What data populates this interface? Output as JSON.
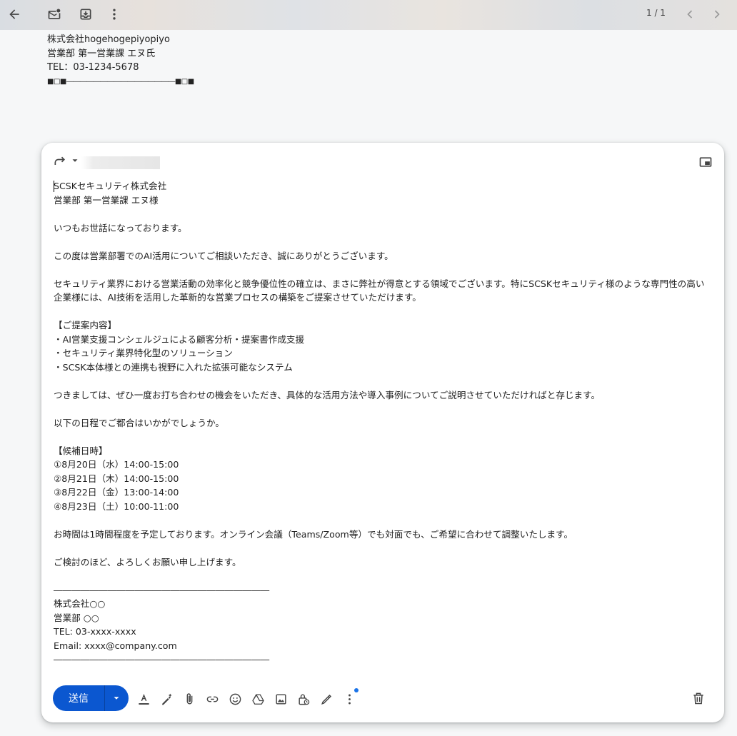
{
  "topbar": {
    "back_icon": "arrow-left-icon",
    "mark_unread_icon": "mark-unread-icon",
    "move_icon": "move-to-inbox-icon",
    "more_icon": "more-vert-icon",
    "pager": "1 / 1",
    "prev_icon": "chevron-left-icon",
    "next_icon": "chevron-right-icon"
  },
  "quoted": {
    "lines": [
      "株式会社hogehogepiyopiyo",
      "営業部 第一営業課 エヌ氏",
      "TEL：03-1234-5678",
      "■□■――――――――――――――――■□■"
    ]
  },
  "compose": {
    "body": [
      "SCSKセキュリティ株式会社",
      "営業部 第一営業課 エヌ様",
      "",
      "いつもお世話になっております。",
      "",
      "この度は営業部署でのAI活用についてご相談いただき、誠にありがとうございます。",
      "",
      "セキュリティ業界における営業活動の効率化と競争優位性の確立は、まさに弊社が得意とする領域でございます。特にSCSKセキュリティ様のような専門性の高い企業様には、AI技術を活用した革新的な営業プロセスの構築をご提案させていただけます。",
      "",
      "【ご提案内容】",
      "・AI営業支援コンシェルジュによる顧客分析・提案書作成支援",
      "・セキュリティ業界特化型のソリューション",
      "・SCSK本体様との連携も視野に入れた拡張可能なシステム",
      "",
      "つきましては、ぜひ一度お打ち合わせの機会をいただき、具体的な活用方法や導入事例についてご説明させていただければと存じます。",
      "",
      "以下の日程でご都合はいかがでしょうか。",
      "",
      "【候補日時】",
      "①8月20日（水）14:00-15:00",
      "②8月21日（木）14:00-15:00",
      "③8月22日（金）13:00-14:00",
      "④8月23日（土）10:00-11:00",
      "",
      "お時間は1時間程度を予定しております。オンライン会議（Teams/Zoom等）でも対面でも、ご希望に合わせて調整いたします。",
      "",
      "ご検討のほど、よろしくお願い申し上げます。",
      "",
      "――――――――――――――――――――――――",
      "株式会社○○",
      "営業部 ○○",
      "TEL: 03-xxxx-xxxx",
      "Email: xxxx@company.com",
      "――――――――――――――――――――――――"
    ],
    "send_label": "送信",
    "accent": "#0b57d0"
  }
}
